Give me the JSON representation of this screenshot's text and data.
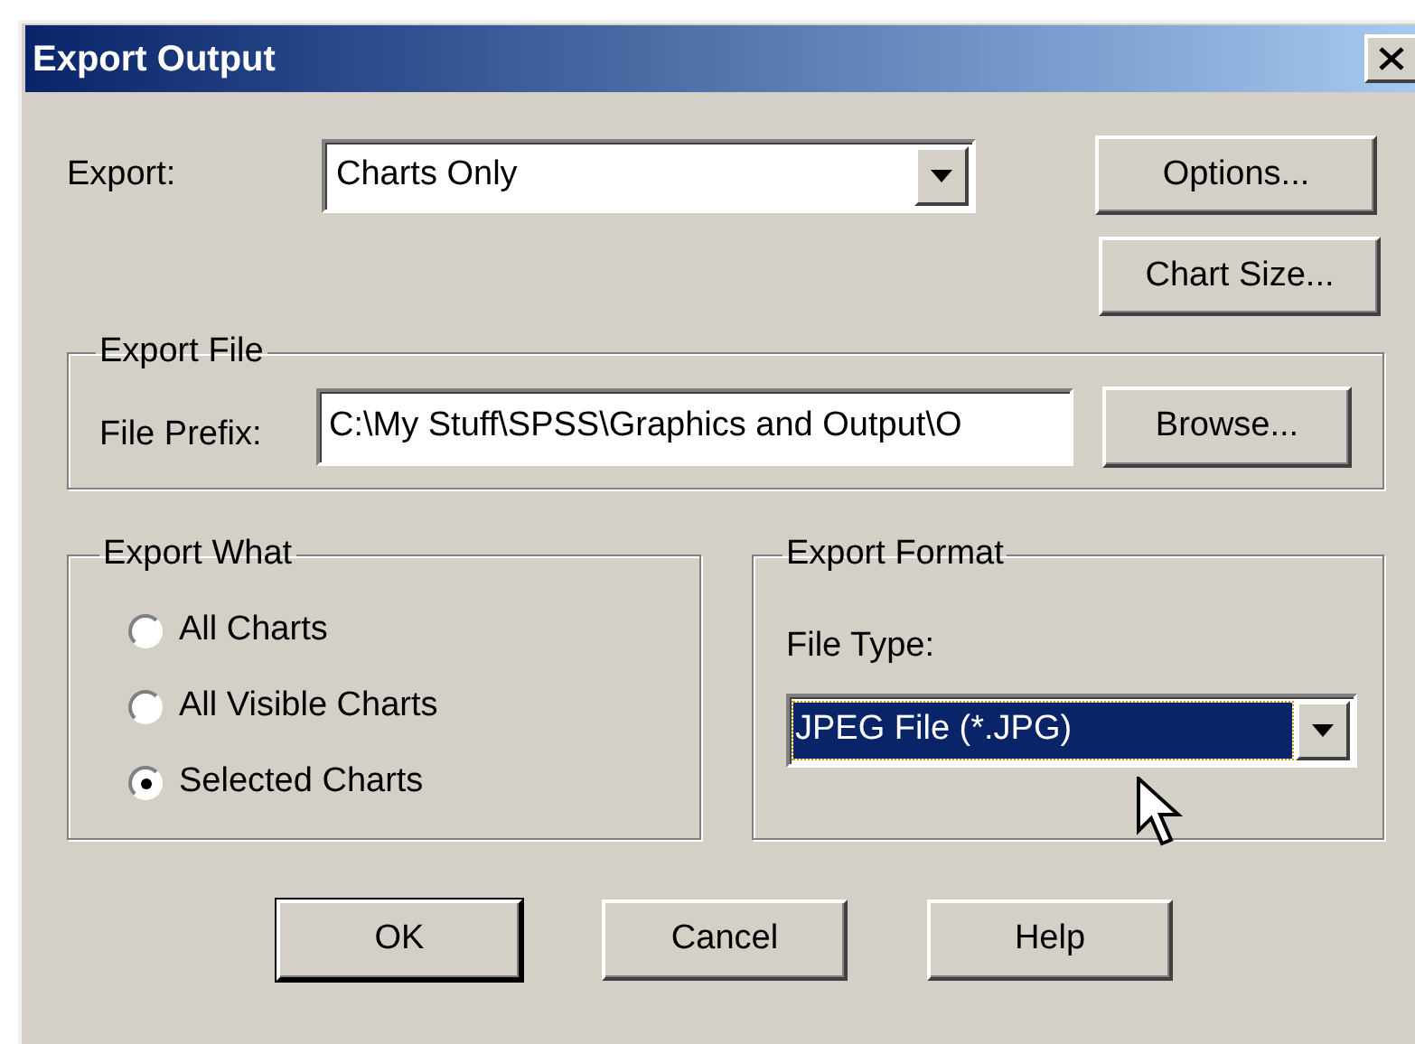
{
  "window": {
    "title": "Export Output"
  },
  "export": {
    "label": "Export:",
    "value": "Charts Only"
  },
  "side_buttons": [
    {
      "label": "Options..."
    },
    {
      "label": "Chart Size..."
    }
  ],
  "export_file": {
    "title": "Export File",
    "prefix_label": "File Prefix:",
    "value": "C:\\My Stuff\\SPSS\\Graphics and Output\\O",
    "browse": {
      "label": "Browse..."
    }
  },
  "export_what": {
    "title": "Export What",
    "options": [
      {
        "label": "All Charts",
        "selected": false
      },
      {
        "label": "All Visible Charts",
        "selected": false
      },
      {
        "label": "Selected Charts",
        "selected": true
      }
    ]
  },
  "export_format": {
    "title": "Export Format",
    "file_type_label": "File Type:",
    "value": "JPEG File (*.JPG)",
    "focused": true
  },
  "buttons": [
    {
      "label": "OK",
      "default": true
    },
    {
      "label": "Cancel",
      "default": false
    },
    {
      "label": "Help",
      "default": false
    }
  ]
}
